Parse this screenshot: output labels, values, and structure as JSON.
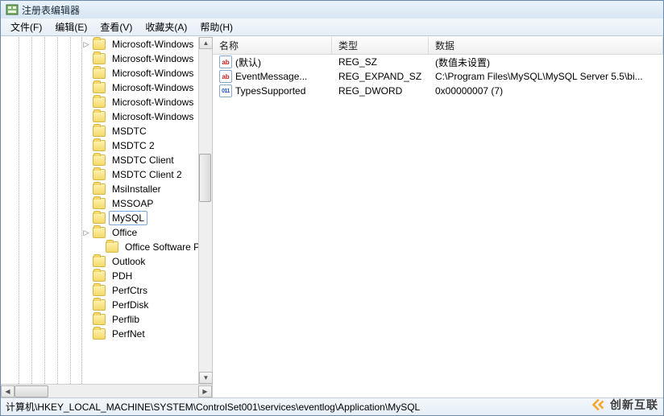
{
  "window": {
    "title": "注册表编辑器"
  },
  "menu": {
    "file": "文件(F)",
    "edit": "编辑(E)",
    "view": "查看(V)",
    "fav": "收藏夹(A)",
    "help": "帮助(H)"
  },
  "tree": {
    "nodes": [
      {
        "label": "Microsoft-Windows",
        "expander": "▷"
      },
      {
        "label": "Microsoft-Windows"
      },
      {
        "label": "Microsoft-Windows"
      },
      {
        "label": "Microsoft-Windows"
      },
      {
        "label": "Microsoft-Windows"
      },
      {
        "label": "Microsoft-Windows"
      },
      {
        "label": "MSDTC"
      },
      {
        "label": "MSDTC 2"
      },
      {
        "label": "MSDTC Client"
      },
      {
        "label": "MSDTC Client 2"
      },
      {
        "label": "MsiInstaller"
      },
      {
        "label": "MSSOAP"
      },
      {
        "label": "MySQL",
        "selected": true
      },
      {
        "label": "Office",
        "expander": "▷"
      },
      {
        "label": "Office Software Pro",
        "deep": true
      },
      {
        "label": "Outlook"
      },
      {
        "label": "PDH"
      },
      {
        "label": "PerfCtrs"
      },
      {
        "label": "PerfDisk"
      },
      {
        "label": "Perflib"
      },
      {
        "label": "PerfNet"
      }
    ]
  },
  "list": {
    "headers": {
      "name": "名称",
      "type": "类型",
      "data": "数据"
    },
    "rows": [
      {
        "icon": "str",
        "iconText": "ab",
        "name": "(默认)",
        "type": "REG_SZ",
        "data": "(数值未设置)"
      },
      {
        "icon": "str",
        "iconText": "ab",
        "name": "EventMessage...",
        "type": "REG_EXPAND_SZ",
        "data": "C:\\Program Files\\MySQL\\MySQL Server 5.5\\bi..."
      },
      {
        "icon": "bin",
        "iconText": "011",
        "name": "TypesSupported",
        "type": "REG_DWORD",
        "data": "0x00000007 (7)"
      }
    ]
  },
  "status": {
    "path": "计算机\\HKEY_LOCAL_MACHINE\\SYSTEM\\ControlSet001\\services\\eventlog\\Application\\MySQL"
  },
  "watermark": {
    "text": "创新互联"
  }
}
